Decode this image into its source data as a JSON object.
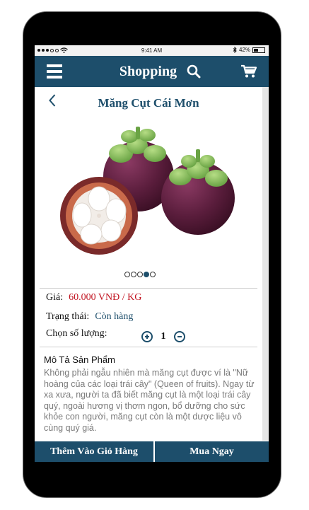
{
  "status_bar": {
    "time": "9:41 AM",
    "battery_text": "42%",
    "battery_level": 0.42,
    "signal_bars": 5,
    "signal_filled": 3
  },
  "navbar": {
    "title": "Shopping",
    "menu_icon": "hamburger-menu-icon",
    "search_icon": "search-icon",
    "cart_icon": "cart-icon"
  },
  "product": {
    "name": "Măng Cụt Cái Mơn",
    "image_icon": "mangosteen-image",
    "carousel": {
      "count": 5,
      "active_index": 3
    },
    "price_label": "Giá:",
    "price_value": "60.000 VNĐ / KG",
    "status_label": "Trạng thái:",
    "status_value": "Còn hàng",
    "quantity_label": "Chọn số lượng:",
    "quantity_value": "1",
    "description_title": "Mô Tả Sản Phẩm",
    "description": "Không phải ngẫu nhiên mà măng cụt được ví là \"Nữ hoàng của các loại trái cây\" (Queen of fruits). Ngay từ xa xưa, người ta đã biết măng cụt là một loại trái cây quý, ngoài hương vị thơm ngon, bổ dưỡng cho sức khỏe con người, măng cụt còn là một dược liệu vô cùng quý giá."
  },
  "actions": {
    "add_to_cart": "Thêm Vào Giỏ Hàng",
    "buy_now": "Mua Ngay"
  },
  "colors": {
    "brand": "#1d4e6b",
    "price": "#c1121f",
    "description": "#7a7a7a"
  }
}
